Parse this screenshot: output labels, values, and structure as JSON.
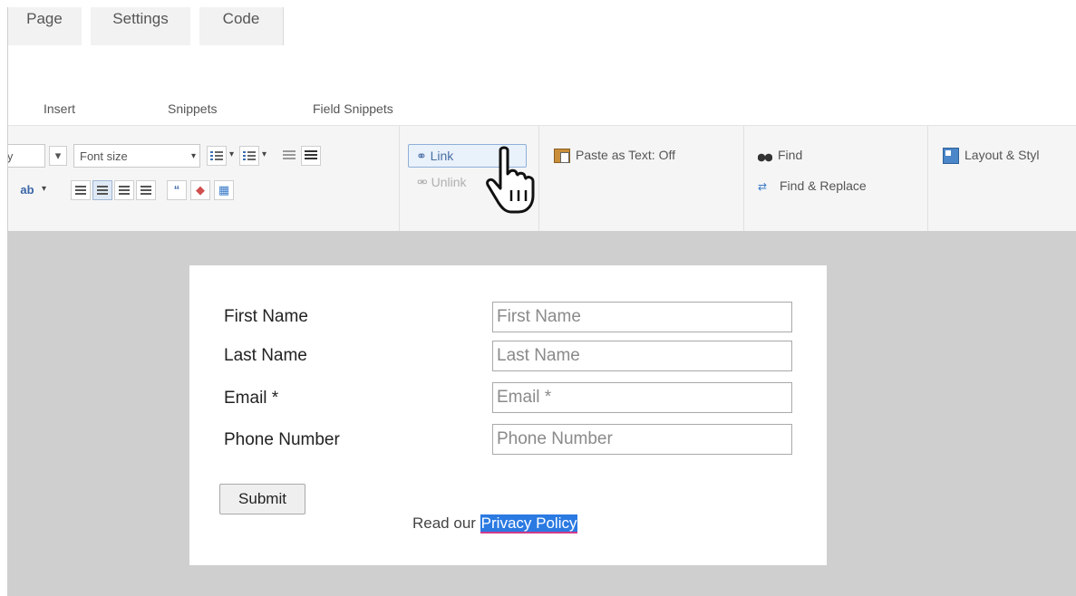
{
  "top_tabs": [
    "Page",
    "Settings",
    "Code"
  ],
  "sub_tabs": [
    "Insert",
    "Snippets",
    "Field Snippets"
  ],
  "toolbar": {
    "font_family_partial": "ly",
    "font_size_label": "Font size",
    "link_label": "Link",
    "unlink_label": "Unlink",
    "paste_label": "Paste as Text: Off",
    "find_label": "Find",
    "find_replace_label": "Find & Replace",
    "layout_label": "Layout & Styl"
  },
  "form": {
    "fields": [
      {
        "label": "First Name",
        "placeholder": "First Name"
      },
      {
        "label": "Last Name",
        "placeholder": "Last Name"
      },
      {
        "label": "Email *",
        "placeholder": "Email *"
      },
      {
        "label": "Phone Number",
        "placeholder": "Phone Number"
      }
    ],
    "submit_label": "Submit",
    "policy_prefix": "Read our",
    "policy_link": "Privacy Policy"
  },
  "colors": {
    "selection_highlight": "#2a7ae2",
    "canvas_background": "#cfcfcf",
    "link_button_border": "#8fb0d8"
  },
  "icons": [
    "bullet-list-icon",
    "numbered-list-icon",
    "indent-icon",
    "outdent-icon",
    "highlight-color-icon",
    "align-left-icon",
    "align-center-icon",
    "align-right-icon",
    "justify-icon",
    "blockquote-icon",
    "eraser-icon",
    "table-icon",
    "link-icon",
    "unlink-icon",
    "paste-text-icon",
    "binoculars-icon",
    "find-replace-icon",
    "layout-icon",
    "hand-cursor-icon"
  ]
}
